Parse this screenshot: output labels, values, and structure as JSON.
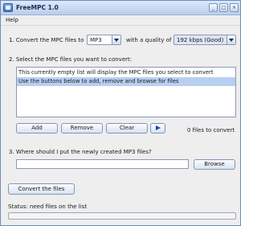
{
  "window": {
    "title": "FreeMPC 1.0"
  },
  "titlebar": {
    "minimize_glyph": "_",
    "maximize_glyph": "□",
    "close_glyph": "×",
    "icon": "app-icon"
  },
  "menu": {
    "help": "Help"
  },
  "step1": {
    "label": "1. Convert the MPC files to",
    "format_value": "MP3",
    "quality_label": "with a quality of",
    "quality_value": "192 kbps (Good)"
  },
  "step2": {
    "label": "2. Select the MPC files you want to convert:",
    "list_items": [
      "This currently empty list will display the MPC files you select to convert",
      "Use the buttons below to add, remove and browse for files"
    ],
    "add_label": "Add",
    "remove_label": "Remove",
    "clear_label": "Clear",
    "count_text": "0 files to convert"
  },
  "step3": {
    "label": "3. Where should I put the newly created MP3 files?",
    "path_value": "",
    "browse_label": "Browse"
  },
  "convert": {
    "label": "Convert the files"
  },
  "status": {
    "text": "Status:  need files on the list",
    "progress": 0
  }
}
